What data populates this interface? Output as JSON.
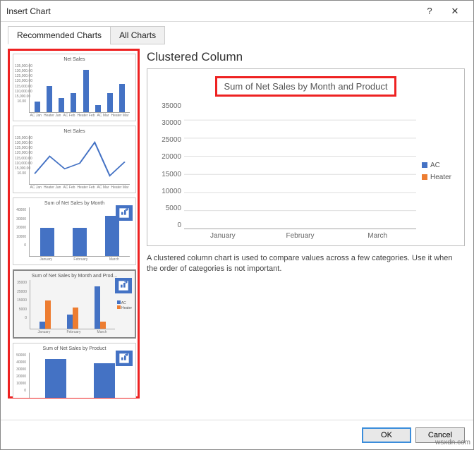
{
  "dialog": {
    "title": "Insert Chart",
    "help_icon": "?",
    "close_icon": "✕"
  },
  "tabs": {
    "recommended": "Recommended Charts",
    "all": "All Charts"
  },
  "thumbs": {
    "t1_title": "Net Sales",
    "t2_title": "Net Sales",
    "t3_title": "Sum of Net Sales by Month",
    "t4_title": "Sum of Net Sales by Month and Prod...",
    "t5_title": "Sum of Net Sales by Product",
    "t4_legend_ac": "AC",
    "t4_legend_heater": "Heater"
  },
  "preview": {
    "heading": "Clustered Column",
    "chart_title": "Sum of Net Sales by Month and Product",
    "description": "A clustered column chart is used to compare values across a few categories. Use it when the order of categories is not important.",
    "legend": {
      "ac": "AC",
      "heater": "Heater"
    }
  },
  "chart_data": {
    "type": "bar",
    "title": "Sum of Net Sales by Month and Product",
    "categories": [
      "January",
      "February",
      "March"
    ],
    "series": [
      {
        "name": "AC",
        "values": [
          5000,
          10000,
          30000
        ],
        "color": "#4472C4"
      },
      {
        "name": "Heater",
        "values": [
          20000,
          15000,
          5000
        ],
        "color": "#ED7D31"
      }
    ],
    "ylim": [
      0,
      35000
    ],
    "yticks": [
      0,
      5000,
      10000,
      15000,
      20000,
      25000,
      30000,
      35000
    ],
    "xlabel": "",
    "ylabel": ""
  },
  "buttons": {
    "ok": "OK",
    "cancel": "Cancel"
  },
  "watermark": "wsxdn.com"
}
